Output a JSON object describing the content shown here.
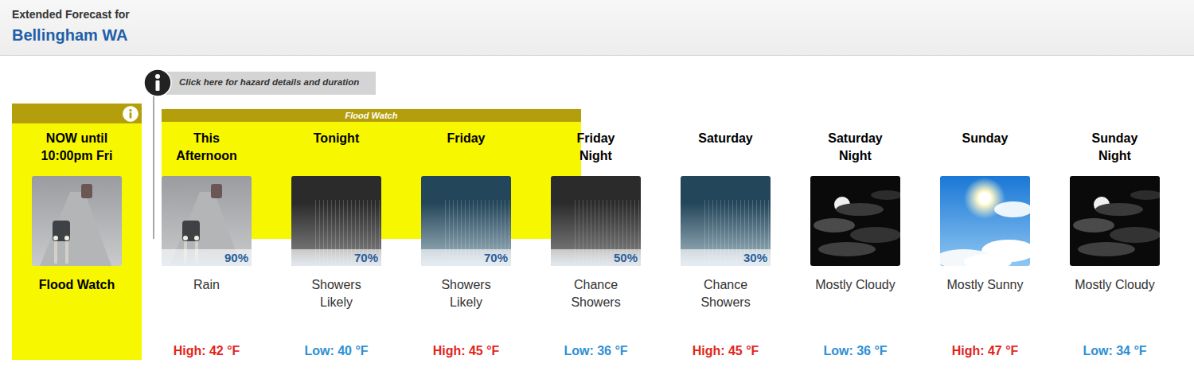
{
  "header": {
    "title": "Extended Forecast for",
    "location": "Bellingham WA"
  },
  "hazard_link": {
    "label": "Click here for hazard details and duration"
  },
  "current_hazard": {
    "time": "NOW until 10:00pm Fri",
    "label": "Flood Watch",
    "kind": "rain"
  },
  "hazard_band": {
    "label": "Flood Watch"
  },
  "periods": [
    {
      "name": "This Afternoon",
      "kind": "rain",
      "pop": "90%",
      "short": "Rain",
      "temp": "High: 42 °F",
      "temp_kind": "high",
      "in_hazard": true
    },
    {
      "name": "Tonight",
      "kind": "showers-night",
      "pop": "70%",
      "short": "Showers Likely",
      "temp": "Low: 40 °F",
      "temp_kind": "low",
      "in_hazard": true
    },
    {
      "name": "Friday",
      "kind": "showers-day",
      "pop": "70%",
      "short": "Showers Likely",
      "temp": "High: 45 °F",
      "temp_kind": "high",
      "in_hazard": true
    },
    {
      "name": "Friday Night",
      "kind": "showers-night",
      "pop": "50%",
      "short": "Chance Showers",
      "temp": "Low: 36 °F",
      "temp_kind": "low",
      "in_hazard": false
    },
    {
      "name": "Saturday",
      "kind": "showers-day",
      "pop": "30%",
      "short": "Chance Showers",
      "temp": "High: 45 °F",
      "temp_kind": "high",
      "in_hazard": false
    },
    {
      "name": "Saturday Night",
      "kind": "cloudy-night",
      "short": "Mostly Cloudy",
      "temp": "Low: 36 °F",
      "temp_kind": "low",
      "in_hazard": false
    },
    {
      "name": "Sunday",
      "kind": "sunny",
      "short": "Mostly Sunny",
      "temp": "High: 47 °F",
      "temp_kind": "high",
      "in_hazard": false
    },
    {
      "name": "Sunday Night",
      "kind": "cloudy-night",
      "short": "Mostly Cloudy",
      "temp": "Low: 34 °F",
      "temp_kind": "low",
      "in_hazard": false
    }
  ]
}
